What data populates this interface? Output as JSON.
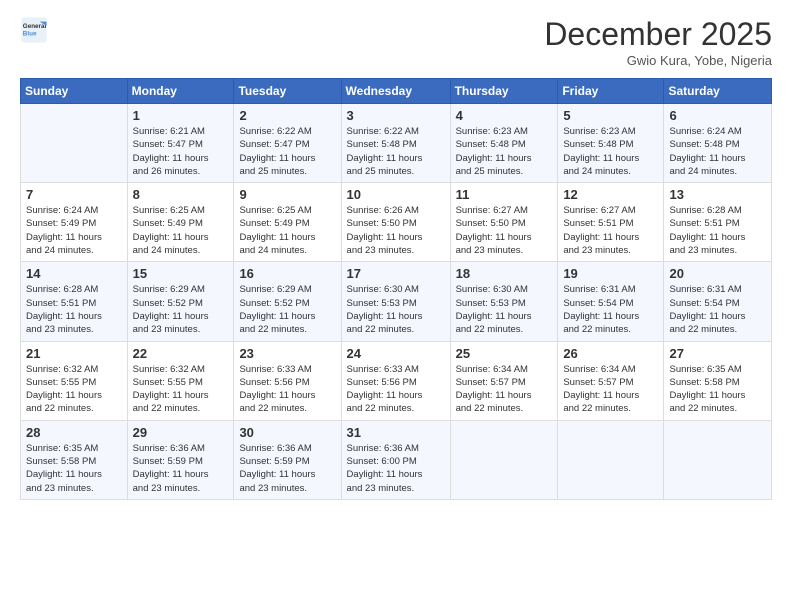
{
  "header": {
    "logo_general": "General",
    "logo_blue": "Blue",
    "title": "December 2025",
    "location": "Gwio Kura, Yobe, Nigeria"
  },
  "calendar": {
    "days_of_week": [
      "Sunday",
      "Monday",
      "Tuesday",
      "Wednesday",
      "Thursday",
      "Friday",
      "Saturday"
    ],
    "weeks": [
      [
        {
          "day": "",
          "info": ""
        },
        {
          "day": "1",
          "info": "Sunrise: 6:21 AM\nSunset: 5:47 PM\nDaylight: 11 hours\nand 26 minutes."
        },
        {
          "day": "2",
          "info": "Sunrise: 6:22 AM\nSunset: 5:47 PM\nDaylight: 11 hours\nand 25 minutes."
        },
        {
          "day": "3",
          "info": "Sunrise: 6:22 AM\nSunset: 5:48 PM\nDaylight: 11 hours\nand 25 minutes."
        },
        {
          "day": "4",
          "info": "Sunrise: 6:23 AM\nSunset: 5:48 PM\nDaylight: 11 hours\nand 25 minutes."
        },
        {
          "day": "5",
          "info": "Sunrise: 6:23 AM\nSunset: 5:48 PM\nDaylight: 11 hours\nand 24 minutes."
        },
        {
          "day": "6",
          "info": "Sunrise: 6:24 AM\nSunset: 5:48 PM\nDaylight: 11 hours\nand 24 minutes."
        }
      ],
      [
        {
          "day": "7",
          "info": "Sunrise: 6:24 AM\nSunset: 5:49 PM\nDaylight: 11 hours\nand 24 minutes."
        },
        {
          "day": "8",
          "info": "Sunrise: 6:25 AM\nSunset: 5:49 PM\nDaylight: 11 hours\nand 24 minutes."
        },
        {
          "day": "9",
          "info": "Sunrise: 6:25 AM\nSunset: 5:49 PM\nDaylight: 11 hours\nand 24 minutes."
        },
        {
          "day": "10",
          "info": "Sunrise: 6:26 AM\nSunset: 5:50 PM\nDaylight: 11 hours\nand 23 minutes."
        },
        {
          "day": "11",
          "info": "Sunrise: 6:27 AM\nSunset: 5:50 PM\nDaylight: 11 hours\nand 23 minutes."
        },
        {
          "day": "12",
          "info": "Sunrise: 6:27 AM\nSunset: 5:51 PM\nDaylight: 11 hours\nand 23 minutes."
        },
        {
          "day": "13",
          "info": "Sunrise: 6:28 AM\nSunset: 5:51 PM\nDaylight: 11 hours\nand 23 minutes."
        }
      ],
      [
        {
          "day": "14",
          "info": "Sunrise: 6:28 AM\nSunset: 5:51 PM\nDaylight: 11 hours\nand 23 minutes."
        },
        {
          "day": "15",
          "info": "Sunrise: 6:29 AM\nSunset: 5:52 PM\nDaylight: 11 hours\nand 23 minutes."
        },
        {
          "day": "16",
          "info": "Sunrise: 6:29 AM\nSunset: 5:52 PM\nDaylight: 11 hours\nand 22 minutes."
        },
        {
          "day": "17",
          "info": "Sunrise: 6:30 AM\nSunset: 5:53 PM\nDaylight: 11 hours\nand 22 minutes."
        },
        {
          "day": "18",
          "info": "Sunrise: 6:30 AM\nSunset: 5:53 PM\nDaylight: 11 hours\nand 22 minutes."
        },
        {
          "day": "19",
          "info": "Sunrise: 6:31 AM\nSunset: 5:54 PM\nDaylight: 11 hours\nand 22 minutes."
        },
        {
          "day": "20",
          "info": "Sunrise: 6:31 AM\nSunset: 5:54 PM\nDaylight: 11 hours\nand 22 minutes."
        }
      ],
      [
        {
          "day": "21",
          "info": "Sunrise: 6:32 AM\nSunset: 5:55 PM\nDaylight: 11 hours\nand 22 minutes."
        },
        {
          "day": "22",
          "info": "Sunrise: 6:32 AM\nSunset: 5:55 PM\nDaylight: 11 hours\nand 22 minutes."
        },
        {
          "day": "23",
          "info": "Sunrise: 6:33 AM\nSunset: 5:56 PM\nDaylight: 11 hours\nand 22 minutes."
        },
        {
          "day": "24",
          "info": "Sunrise: 6:33 AM\nSunset: 5:56 PM\nDaylight: 11 hours\nand 22 minutes."
        },
        {
          "day": "25",
          "info": "Sunrise: 6:34 AM\nSunset: 5:57 PM\nDaylight: 11 hours\nand 22 minutes."
        },
        {
          "day": "26",
          "info": "Sunrise: 6:34 AM\nSunset: 5:57 PM\nDaylight: 11 hours\nand 22 minutes."
        },
        {
          "day": "27",
          "info": "Sunrise: 6:35 AM\nSunset: 5:58 PM\nDaylight: 11 hours\nand 22 minutes."
        }
      ],
      [
        {
          "day": "28",
          "info": "Sunrise: 6:35 AM\nSunset: 5:58 PM\nDaylight: 11 hours\nand 23 minutes."
        },
        {
          "day": "29",
          "info": "Sunrise: 6:36 AM\nSunset: 5:59 PM\nDaylight: 11 hours\nand 23 minutes."
        },
        {
          "day": "30",
          "info": "Sunrise: 6:36 AM\nSunset: 5:59 PM\nDaylight: 11 hours\nand 23 minutes."
        },
        {
          "day": "31",
          "info": "Sunrise: 6:36 AM\nSunset: 6:00 PM\nDaylight: 11 hours\nand 23 minutes."
        },
        {
          "day": "",
          "info": ""
        },
        {
          "day": "",
          "info": ""
        },
        {
          "day": "",
          "info": ""
        }
      ]
    ]
  }
}
